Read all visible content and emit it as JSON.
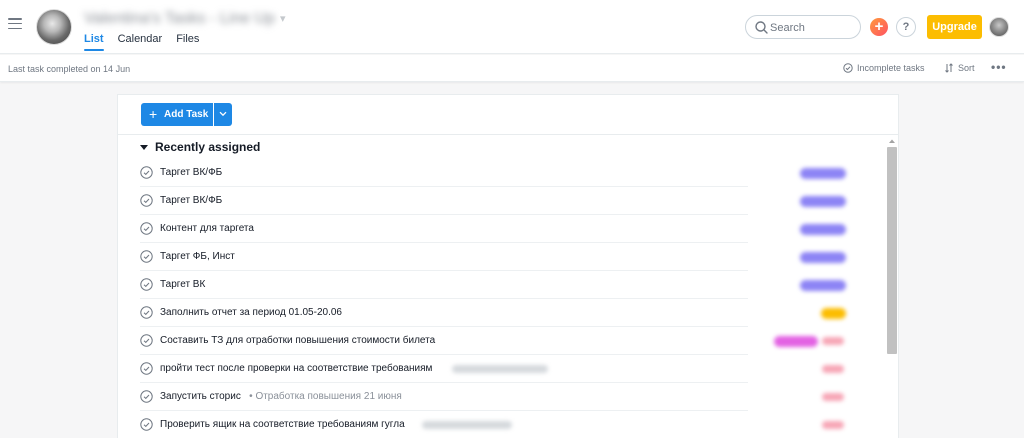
{
  "header": {
    "project_title": "Valentina's Tasks - Line Up",
    "tabs": [
      {
        "label": "List",
        "active": true
      },
      {
        "label": "Calendar",
        "active": false
      },
      {
        "label": "Files",
        "active": false
      }
    ],
    "search_placeholder": "Search",
    "plus_label": "+",
    "help_label": "?",
    "upgrade_label": "Upgrade"
  },
  "subbar": {
    "last_completed": "Last task completed on 14 Jun",
    "incomplete_label": "Incomplete tasks",
    "sort_label": "Sort",
    "more_label": "•••"
  },
  "toolbar": {
    "add_task_label": "Add Task"
  },
  "section": {
    "title": "Recently assigned"
  },
  "tasks": [
    {
      "name": "Таргет ВК/ФБ",
      "sub": ""
    },
    {
      "name": "Таргет ВК/ФБ",
      "sub": ""
    },
    {
      "name": "Контент для таргета",
      "sub": ""
    },
    {
      "name": "Таргет ФБ, Инст",
      "sub": ""
    },
    {
      "name": "Таргет ВК",
      "sub": ""
    },
    {
      "name": "Заполнить отчет за период 01.05-20.06",
      "sub": ""
    },
    {
      "name": "Составить ТЗ для отработки повышения стоимости билета",
      "sub": ""
    },
    {
      "name": "пройти тест после проверки на соответствие требованиям",
      "sub": ""
    },
    {
      "name": "Запустить сторис",
      "sub": "• Отработка повышения 21 июня"
    },
    {
      "name": "Проверить ящик на соответствие требованиям гугла",
      "sub": ""
    }
  ],
  "colors": {
    "accent": "#1e88e5",
    "upgrade": "#fcbd01",
    "tag_purple": "#8d84f5",
    "tag_orange": "#fcbd01",
    "tag_pink": "#e362e3",
    "due_red": "#f7a6b6"
  },
  "icons": {
    "menu": "hamburger-icon",
    "search": "search-icon",
    "task_check": "check-circle-icon",
    "sort": "sort-icon",
    "dropdown": "chevron-down-icon"
  }
}
